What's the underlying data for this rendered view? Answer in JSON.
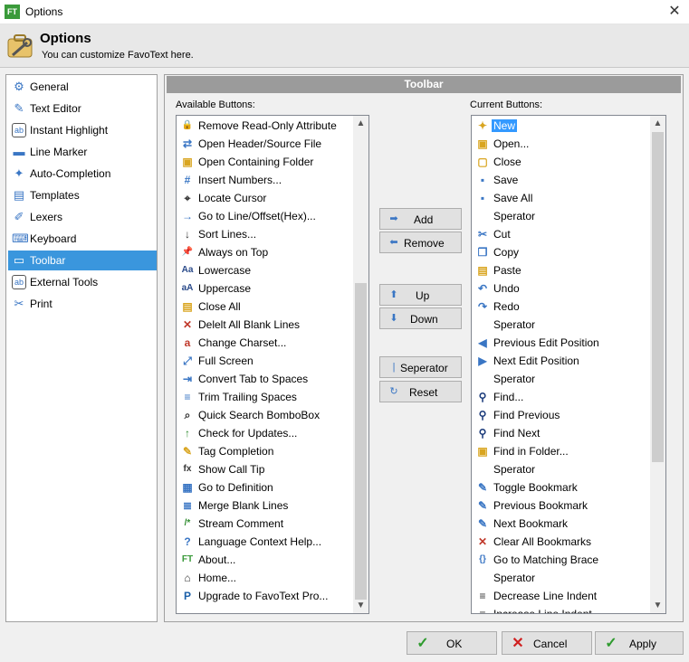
{
  "window": {
    "title": "Options",
    "app_badge": "FT",
    "close_glyph": "✕"
  },
  "header": {
    "title": "Options",
    "subtitle": "You can customize FavoText here."
  },
  "nav": {
    "items": [
      {
        "label": "General",
        "icon": "gear-icon",
        "glyph": "⚙"
      },
      {
        "label": "Text Editor",
        "icon": "text-editor-icon",
        "glyph": "✎"
      },
      {
        "label": "Instant Highlight",
        "icon": "highlight-icon",
        "glyph": "ab"
      },
      {
        "label": "Line Marker",
        "icon": "line-marker-icon",
        "glyph": "▬"
      },
      {
        "label": "Auto-Completion",
        "icon": "auto-completion-icon",
        "glyph": "✦"
      },
      {
        "label": "Templates",
        "icon": "templates-icon",
        "glyph": "▤"
      },
      {
        "label": "Lexers",
        "icon": "lexers-icon",
        "glyph": "✐"
      },
      {
        "label": "Keyboard",
        "icon": "keyboard-icon",
        "glyph": "⌨"
      },
      {
        "label": "Toolbar",
        "icon": "toolbar-icon",
        "glyph": "▭"
      },
      {
        "label": "External Tools",
        "icon": "external-tools-icon",
        "glyph": "ab"
      },
      {
        "label": "Print",
        "icon": "print-icon",
        "glyph": "✂"
      }
    ],
    "selected": "Toolbar"
  },
  "panel": {
    "title": "Toolbar",
    "available_label": "Available Buttons:",
    "current_label": "Current Buttons:",
    "available": [
      {
        "label": "Remove Read-Only Attribute",
        "glyph": "🔒",
        "color": "#b08a3a"
      },
      {
        "label": "Open Header/Source File",
        "glyph": "⇄",
        "color": "#3a76c4"
      },
      {
        "label": "Open Containing Folder",
        "glyph": "▣",
        "color": "#d9a520"
      },
      {
        "label": "Insert Numbers...",
        "glyph": "#",
        "color": "#3a76c4"
      },
      {
        "label": "Locate Cursor",
        "glyph": "⌖",
        "color": "#333333"
      },
      {
        "label": "Go to Line/Offset(Hex)...",
        "glyph": "→",
        "color": "#3a76c4"
      },
      {
        "label": "Sort Lines...",
        "glyph": "↓",
        "color": "#333333"
      },
      {
        "label": "Always on Top",
        "glyph": "📌",
        "color": "#3a76c4"
      },
      {
        "label": "Lowercase",
        "glyph": "Aa",
        "color": "#2a4a8a"
      },
      {
        "label": "Uppercase",
        "glyph": "aA",
        "color": "#2a4a8a"
      },
      {
        "label": "Close All",
        "glyph": "▤",
        "color": "#d9a520"
      },
      {
        "label": "Delelt All Blank Lines",
        "glyph": "✕",
        "color": "#c0392b"
      },
      {
        "label": "Change Charset...",
        "glyph": "a",
        "color": "#c0392b"
      },
      {
        "label": "Full Screen",
        "glyph": "⤢",
        "color": "#3a76c4"
      },
      {
        "label": "Convert Tab to Spaces",
        "glyph": "⇥",
        "color": "#3a76c4"
      },
      {
        "label": "Trim Trailing Spaces",
        "glyph": "≡",
        "color": "#3a76c4"
      },
      {
        "label": "Quick Search BomboBox",
        "glyph": "⌕",
        "color": "#333333"
      },
      {
        "label": "Check for Updates...",
        "glyph": "↑",
        "color": "#2e8b2e"
      },
      {
        "label": "Tag Completion",
        "glyph": "✎",
        "color": "#d9a520"
      },
      {
        "label": "Show Call Tip",
        "glyph": "fx",
        "color": "#333333"
      },
      {
        "label": "Go to Definition",
        "glyph": "▦",
        "color": "#3a76c4"
      },
      {
        "label": "Merge Blank Lines",
        "glyph": "≣",
        "color": "#3a76c4"
      },
      {
        "label": "Stream Comment",
        "glyph": "/*",
        "color": "#2e8b2e"
      },
      {
        "label": "Language Context Help...",
        "glyph": "?",
        "color": "#3a76c4"
      },
      {
        "label": "About...",
        "glyph": "FT",
        "color": "#3a9a3a"
      },
      {
        "label": "Home...",
        "glyph": "⌂",
        "color": "#333333"
      },
      {
        "label": "Upgrade to FavoText Pro...",
        "glyph": "P",
        "color": "#1a5fa8"
      }
    ],
    "current": [
      {
        "label": "New",
        "glyph": "✦",
        "color": "#d9a520"
      },
      {
        "label": "Open...",
        "glyph": "▣",
        "color": "#d9a520"
      },
      {
        "label": "Close",
        "glyph": "▢",
        "color": "#d9a520"
      },
      {
        "label": "Save",
        "glyph": "▪",
        "color": "#3a76c4"
      },
      {
        "label": "Save All",
        "glyph": "▪",
        "color": "#3a76c4"
      },
      {
        "label": "Sperator",
        "glyph": "",
        "color": "#333333"
      },
      {
        "label": "Cut",
        "glyph": "✂",
        "color": "#3a76c4"
      },
      {
        "label": "Copy",
        "glyph": "❐",
        "color": "#3a76c4"
      },
      {
        "label": "Paste",
        "glyph": "▤",
        "color": "#d9a520"
      },
      {
        "label": "Undo",
        "glyph": "↶",
        "color": "#3a76c4"
      },
      {
        "label": "Redo",
        "glyph": "↷",
        "color": "#3a76c4"
      },
      {
        "label": "Sperator",
        "glyph": "",
        "color": "#333333"
      },
      {
        "label": "Previous Edit Position",
        "glyph": "◀",
        "color": "#3a76c4"
      },
      {
        "label": "Next Edit Position",
        "glyph": "▶",
        "color": "#3a76c4"
      },
      {
        "label": "Sperator",
        "glyph": "",
        "color": "#333333"
      },
      {
        "label": "Find...",
        "glyph": "⚲",
        "color": "#1a3a7a"
      },
      {
        "label": "Find Previous",
        "glyph": "⚲",
        "color": "#1a3a7a"
      },
      {
        "label": "Find Next",
        "glyph": "⚲",
        "color": "#1a3a7a"
      },
      {
        "label": "Find in Folder...",
        "glyph": "▣",
        "color": "#d9a520"
      },
      {
        "label": "Sperator",
        "glyph": "",
        "color": "#333333"
      },
      {
        "label": "Toggle Bookmark",
        "glyph": "✎",
        "color": "#3a76c4"
      },
      {
        "label": "Previous Bookmark",
        "glyph": "✎",
        "color": "#3a76c4"
      },
      {
        "label": "Next Bookmark",
        "glyph": "✎",
        "color": "#3a76c4"
      },
      {
        "label": "Clear All Bookmarks",
        "glyph": "✕",
        "color": "#c0392b"
      },
      {
        "label": "Go to Matching Brace",
        "glyph": "{}",
        "color": "#3a76c4"
      },
      {
        "label": "Sperator",
        "glyph": "",
        "color": "#333333"
      },
      {
        "label": "Decrease Line Indent",
        "glyph": "≡",
        "color": "#333333"
      },
      {
        "label": "Increase Line Indent",
        "glyph": "≡",
        "color": "#333333"
      }
    ],
    "selected_current": "New",
    "buttons": {
      "add": "Add",
      "remove": "Remove",
      "up": "Up",
      "down": "Down",
      "separator": "Seperator",
      "reset": "Reset"
    }
  },
  "footer": {
    "ok": "OK",
    "cancel": "Cancel",
    "apply": "Apply"
  },
  "colors": {
    "accent": "#3a96dd",
    "selection": "#3399ff",
    "header_bar": "#9b9b9b"
  }
}
